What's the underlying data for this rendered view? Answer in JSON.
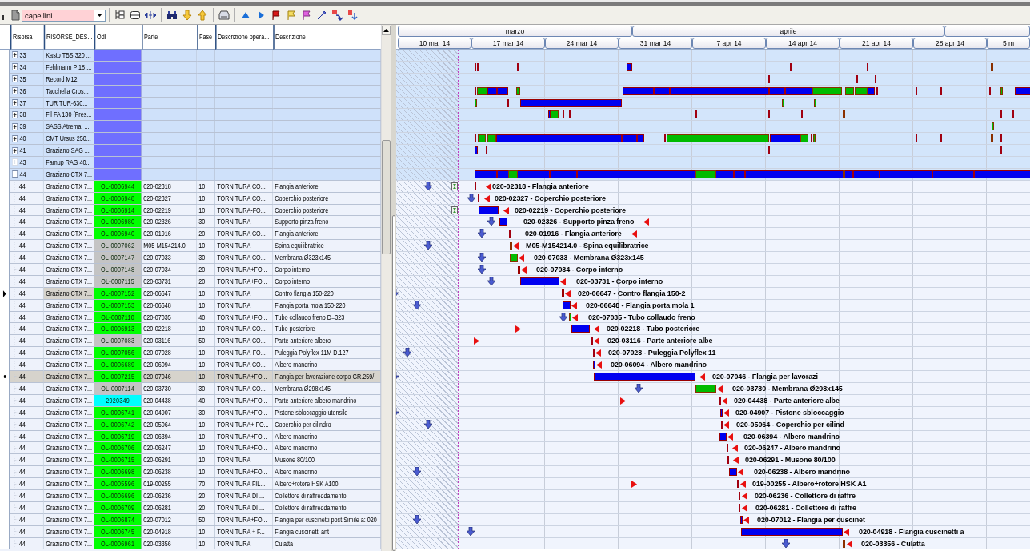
{
  "toolbar": {
    "filter": "capellini"
  },
  "gantt": {
    "months": [
      {
        "label": "marzo"
      },
      {
        "label": "aprile"
      }
    ],
    "weeks": [
      {
        "label": "10 mar 14"
      },
      {
        "label": "17 mar 14"
      },
      {
        "label": "24 mar 14"
      },
      {
        "label": "31 mar 14"
      },
      {
        "label": "7 apr 14"
      },
      {
        "label": "14 apr 14"
      },
      {
        "label": "21 apr 14"
      },
      {
        "label": "28 apr 14"
      },
      {
        "label": "5 m"
      }
    ]
  },
  "table": {
    "columns": [
      "Risorsa",
      "RISORSE_DES...",
      "Odl",
      "Parte",
      "Fase",
      "Descrizione opera...",
      "Descrizione"
    ],
    "resources": [
      {
        "id": "33",
        "name": "Kasto TBS 320 ...",
        "color": "#6f6fff",
        "has_children": true,
        "expanded": false
      },
      {
        "id": "34",
        "name": "Fehlmann P 18 ...",
        "color": "#6f6fff",
        "has_children": true,
        "expanded": false
      },
      {
        "id": "35",
        "name": "Record M12",
        "color": "#6f6fff",
        "has_children": true,
        "expanded": false
      },
      {
        "id": "36",
        "name": "Tacchella Cros...",
        "color": "#6f6fff",
        "has_children": true,
        "expanded": false
      },
      {
        "id": "37",
        "name": "TUR TUR-630...",
        "color": "#6f6fff",
        "has_children": true,
        "expanded": false
      },
      {
        "id": "38",
        "name": "Fil FA 130 (Fres...",
        "color": "#6f6fff",
        "has_children": true,
        "expanded": false
      },
      {
        "id": "39",
        "name": "SASS Atrema  ...",
        "color": "#6f6fff",
        "has_children": true,
        "expanded": false
      },
      {
        "id": "40",
        "name": "CMT Ursus 250...",
        "color": "#6f6fff",
        "has_children": true,
        "expanded": false
      },
      {
        "id": "41",
        "name": "Graziano SAG ...",
        "color": "#6f6fff",
        "has_children": true,
        "expanded": false
      },
      {
        "id": "43",
        "name": "Famup RAG 40...",
        "color": "#6f6fff",
        "has_children": false,
        "expanded": false
      },
      {
        "id": "44",
        "name": "Graziano CTX 7...",
        "color": "#6f6fff",
        "has_children": true,
        "expanded": true
      }
    ],
    "tasks": [
      {
        "risorsa": "44",
        "name": "Graziano CTX 7...",
        "odl": "OL-0006944",
        "color": "#00ff00",
        "parte": "020-02318",
        "fase": "10",
        "operazione": "TORNITURA CO...",
        "descrizione": "Flangia anteriore",
        "selected": false,
        "focused": false,
        "label": "020-02318 - Flangia anteriore"
      },
      {
        "risorsa": "44",
        "name": "Graziano CTX 7...",
        "odl": "OL-0006948",
        "color": "#00ff00",
        "parte": "020-02327",
        "fase": "10",
        "operazione": "TORNITURA CO...",
        "descrizione": "Coperchio posteriore",
        "selected": false,
        "focused": false,
        "label": "020-02327 - Coperchio posteriore"
      },
      {
        "risorsa": "44",
        "name": "Graziano CTX 7...",
        "odl": "OL-0006914",
        "color": "#00ff00",
        "parte": "020-02219",
        "fase": "10",
        "operazione": "TORNITURA-FO...",
        "descrizione": "Coperchio posteriore",
        "selected": false,
        "focused": false,
        "label": "020-02219 - Coperchio posteriore"
      },
      {
        "risorsa": "44",
        "name": "Graziano CTX 7...",
        "odl": "OL-0006980",
        "color": "#00ff00",
        "parte": "020-02326",
        "fase": "30",
        "operazione": "TORNITURA",
        "descrizione": "Supporto pinza freno",
        "selected": false,
        "focused": false,
        "label": "020-02326 - Supporto pinza freno"
      },
      {
        "risorsa": "44",
        "name": "Graziano CTX 7...",
        "odl": "OL-0006940",
        "color": "#00ff00",
        "parte": "020-01916",
        "fase": "20",
        "operazione": "TORNITURA CO...",
        "descrizione": "Flangia anteriore",
        "selected": false,
        "focused": false,
        "label": "020-01916 - Flangia anteriore"
      },
      {
        "risorsa": "44",
        "name": "Graziano CTX 7...",
        "odl": "OL-0007062",
        "color": "#c4c4c4",
        "parte": "M05-M154214.0",
        "fase": "10",
        "operazione": "TORNITURA",
        "descrizione": "Spina equilibratrice",
        "selected": false,
        "focused": false,
        "label": "M05-M154214.0 - Spina equilibratrice"
      },
      {
        "risorsa": "44",
        "name": "Graziano CTX 7...",
        "odl": "OL-0007147",
        "color": "#c4c4c4",
        "parte": "020-07033",
        "fase": "30",
        "operazione": "TORNITURA CO...",
        "descrizione": "Membrana Ø323x145",
        "selected": false,
        "focused": false,
        "label": "020-07033 - Membrana Ø323x145"
      },
      {
        "risorsa": "44",
        "name": "Graziano CTX 7...",
        "odl": "OL-0007148",
        "color": "#c4c4c4",
        "parte": "020-07034",
        "fase": "20",
        "operazione": "TORNITURA+FO...",
        "descrizione": "Corpo interno",
        "selected": false,
        "focused": false,
        "label": "020-07034 - Corpo interno"
      },
      {
        "risorsa": "44",
        "name": "Graziano CTX 7...",
        "odl": "OL-0007115",
        "color": "#c4c4c4",
        "parte": "020-03731",
        "fase": "20",
        "operazione": "TORNITURA+FO...",
        "descrizione": "Corpo interno",
        "selected": false,
        "focused": false,
        "label": "020-03731 - Corpo interno"
      },
      {
        "risorsa": "44",
        "name": "Graziano CTX 7...",
        "odl": "OL-0007152",
        "color": "#00ff00",
        "parte": "020-06647",
        "fase": "10",
        "operazione": "TORNITURA",
        "descrizione": "Contro flangia 150-220",
        "selected": false,
        "focused": true,
        "label": "020-06647 - Contro flangia 150-2"
      },
      {
        "risorsa": "44",
        "name": "Graziano CTX 7...",
        "odl": "OL-0007153",
        "color": "#00ff00",
        "parte": "020-06648",
        "fase": "10",
        "operazione": "TORNITURA",
        "descrizione": "Flangia porta mola 150-220",
        "selected": false,
        "focused": false,
        "label": "020-06648 - Flangia porta mola 1"
      },
      {
        "risorsa": "44",
        "name": "Graziano CTX 7...",
        "odl": "OL-0007110",
        "color": "#00ff00",
        "parte": "020-07035",
        "fase": "40",
        "operazione": "TORNITURA+FO...",
        "descrizione": "Tubo collaudo freno D=323",
        "selected": false,
        "focused": false,
        "label": "020-07035 - Tubo collaudo freno"
      },
      {
        "risorsa": "44",
        "name": "Graziano CTX 7...",
        "odl": "OL-0006913",
        "color": "#00ff00",
        "parte": "020-02218",
        "fase": "10",
        "operazione": "TORNITURA CO...",
        "descrizione": "Tubo posteriore",
        "selected": false,
        "focused": false,
        "label": "020-02218 - Tubo posteriore"
      },
      {
        "risorsa": "44",
        "name": "Graziano CTX 7...",
        "odl": "OL-0007083",
        "color": "#c4c4c4",
        "parte": "020-03116",
        "fase": "50",
        "operazione": "TORNITURA CO...",
        "descrizione": "Parte anteriore albero",
        "selected": false,
        "focused": false,
        "label": "020-03116 - Parte anteriore albe"
      },
      {
        "risorsa": "44",
        "name": "Graziano CTX 7...",
        "odl": "OL-0007056",
        "color": "#00ff00",
        "parte": "020-07028",
        "fase": "10",
        "operazione": "TORNITURA-FO...",
        "descrizione": "Puleggia Polyflex 11M D.127",
        "selected": false,
        "focused": false,
        "label": "020-07028 - Puleggia Polyflex 11"
      },
      {
        "risorsa": "44",
        "name": "Graziano CTX 7...",
        "odl": "OL-0006689",
        "color": "#00ff00",
        "parte": "020-06094",
        "fase": "10",
        "operazione": "TORNITURA CO...",
        "descrizione": "Albero mandrino",
        "selected": false,
        "focused": false,
        "label": "020-06094 - Albero mandrino"
      },
      {
        "risorsa": "44",
        "name": "Graziano CTX 7...",
        "odl": "OL-0007215",
        "color": "#00ff00",
        "parte": "020-07046",
        "fase": "10",
        "operazione": "TORNITURA+FO...",
        "descrizione": "Flangia per lavorazione corpo GR.259/",
        "selected": true,
        "focused": false,
        "label": "020-07046 - Flangia per lavorazi"
      },
      {
        "risorsa": "44",
        "name": "Graziano CTX 7...",
        "odl": "OL-0007114",
        "color": "#c4c4c4",
        "parte": "020-03730",
        "fase": "30",
        "operazione": "TORNITURA CO...",
        "descrizione": "Membrana Ø298x145",
        "selected": false,
        "focused": false,
        "label": "020-03730 - Membrana Ø298x145"
      },
      {
        "risorsa": "44",
        "name": "Graziano CTX 7...",
        "odl": "2920349",
        "color": "#00ffff",
        "parte": "020-04438",
        "fase": "40",
        "operazione": "TORNITURA+FO...",
        "descrizione": "Parte anteriore albero mandrino",
        "selected": false,
        "focused": false,
        "label": "020-04438 - Parte anteriore albe"
      },
      {
        "risorsa": "44",
        "name": "Graziano CTX 7...",
        "odl": "OL-0006741",
        "color": "#00ff00",
        "parte": "020-04907",
        "fase": "30",
        "operazione": "TORNITURA+FO...",
        "descrizione": "Pistone sbloccaggio utensile",
        "selected": false,
        "focused": false,
        "label": "020-04907 - Pistone sbloccaggio"
      },
      {
        "risorsa": "44",
        "name": "Graziano CTX 7...",
        "odl": "OL-0006742",
        "color": "#00ff00",
        "parte": "020-05064",
        "fase": "10",
        "operazione": "TORNITURA+ FO...",
        "descrizione": "Coperchio per cilindro",
        "selected": false,
        "focused": false,
        "label": "020-05064 - Coperchio per cilind"
      },
      {
        "risorsa": "44",
        "name": "Graziano CTX 7...",
        "odl": "OL-0006719",
        "color": "#00ff00",
        "parte": "020-06394",
        "fase": "10",
        "operazione": "TORNITURA+FO...",
        "descrizione": "Albero mandrino",
        "selected": false,
        "focused": false,
        "label": "020-06394 - Albero mandrino"
      },
      {
        "risorsa": "44",
        "name": "Graziano CTX 7...",
        "odl": "OL-0006706",
        "color": "#00ff00",
        "parte": "020-06247",
        "fase": "10",
        "operazione": "TORNITURA+FO...",
        "descrizione": "Albero mandrino",
        "selected": false,
        "focused": false,
        "label": "020-06247 - Albero mandrino"
      },
      {
        "risorsa": "44",
        "name": "Graziano CTX 7...",
        "odl": "OL-0006715",
        "color": "#00ff00",
        "parte": "020-06291",
        "fase": "10",
        "operazione": "TORNITURA",
        "descrizione": "Musone 80/100",
        "selected": false,
        "focused": false,
        "label": "020-06291 - Musone 80/100"
      },
      {
        "risorsa": "44",
        "name": "Graziano CTX 7...",
        "odl": "OL-0006698",
        "color": "#00ff00",
        "parte": "020-06238",
        "fase": "10",
        "operazione": "TORNITURA+FO...",
        "descrizione": "Albero mandrino",
        "selected": false,
        "focused": false,
        "label": "020-06238 - Albero mandrino"
      },
      {
        "risorsa": "44",
        "name": "Graziano CTX 7...",
        "odl": "OL-0005596",
        "color": "#00ff00",
        "parte": "019-00255",
        "fase": "70",
        "operazione": "TORNITURA FIL...",
        "descrizione": "Albero+rotore HSK A100",
        "selected": false,
        "focused": false,
        "label": "019-00255 - Albero+rotore HSK A1"
      },
      {
        "risorsa": "44",
        "name": "Graziano CTX 7...",
        "odl": "OL-0006696",
        "color": "#00ff00",
        "parte": "020-06236",
        "fase": "20",
        "operazione": "TORNITURA DI ...",
        "descrizione": "Collettore di raffreddamento",
        "selected": false,
        "focused": false,
        "label": "020-06236 - Collettore di raffre"
      },
      {
        "risorsa": "44",
        "name": "Graziano CTX 7...",
        "odl": "OL-0006709",
        "color": "#00ff00",
        "parte": "020-06281",
        "fase": "20",
        "operazione": "TORNITURA DI ...",
        "descrizione": "Collettore di raffreddamento",
        "selected": false,
        "focused": false,
        "label": "020-06281 - Collettore di raffre"
      },
      {
        "risorsa": "44",
        "name": "Graziano CTX 7...",
        "odl": "OL-0006874",
        "color": "#00ff00",
        "parte": "020-07012",
        "fase": "50",
        "operazione": "TORNITURA+FO...",
        "descrizione": "Flangia per cuscinetti post.Simile a: 020",
        "selected": false,
        "focused": false,
        "label": "020-07012 - Flangia per cuscinet"
      },
      {
        "risorsa": "44",
        "name": "Graziano CTX 7...",
        "odl": "OL-0006745",
        "color": "#00ff00",
        "parte": "020-04918",
        "fase": "10",
        "operazione": "TORNITURA + F...",
        "descrizione": "Flangia cuscinetti ant",
        "selected": false,
        "focused": false,
        "label": "020-04918 - Flangia cuscinetti a"
      },
      {
        "risorsa": "44",
        "name": "Graziano CTX 7...",
        "odl": "OL-0006961",
        "color": "#00ff00",
        "parte": "020-03356",
        "fase": "10",
        "operazione": "TORNITURA",
        "descrizione": "Culatta",
        "selected": false,
        "focused": false,
        "label": "020-03356 - Culatta"
      }
    ]
  }
}
